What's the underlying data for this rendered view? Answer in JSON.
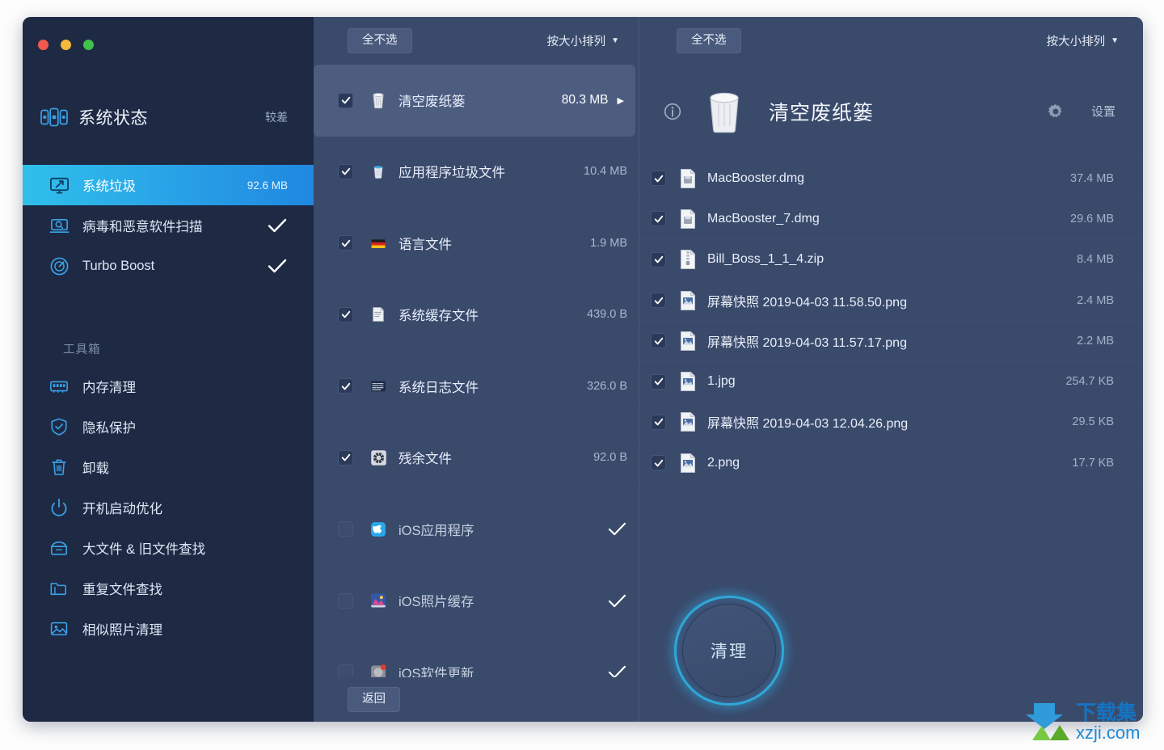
{
  "window": {
    "traffic_lights": [
      "close",
      "minimize",
      "zoom"
    ]
  },
  "sidebar": {
    "status": {
      "title": "系统状态",
      "value": "较差",
      "icon": "system-status-icon"
    },
    "nav_items": [
      {
        "label": "系统垃圾",
        "value": "92.6 MB",
        "icon": "monitor-clean-icon",
        "active": true
      },
      {
        "label": "病毒和恶意软件扫描",
        "value": "",
        "icon": "laptop-scan-icon",
        "active": false,
        "checked": true
      },
      {
        "label": "Turbo Boost",
        "value": "",
        "icon": "turbo-boost-icon",
        "active": false,
        "checked": true
      }
    ],
    "tools_label": "工具箱",
    "tools": [
      {
        "label": "内存清理",
        "icon": "memory-icon"
      },
      {
        "label": "隐私保护",
        "icon": "shield-check-icon"
      },
      {
        "label": "卸载",
        "icon": "trash-icon"
      },
      {
        "label": "开机启动优化",
        "icon": "power-icon"
      },
      {
        "label": "大文件 & 旧文件查找",
        "icon": "box-icon"
      },
      {
        "label": "重复文件查找",
        "icon": "folder-icon"
      },
      {
        "label": "相似照片清理",
        "icon": "photo-icon"
      }
    ]
  },
  "middle": {
    "deselect_label": "全不选",
    "sort_label": "按大小排列",
    "sort_caret": "▼",
    "back_label": "返回",
    "rows": [
      {
        "name": "清空废纸篓",
        "size": "80.3 MB",
        "icon": "trash-bin-icon",
        "checked": true,
        "selected": true,
        "arrow": "▶"
      },
      {
        "name": "应用程序垃圾文件",
        "size": "10.4 MB",
        "icon": "app-trash-icon",
        "checked": true,
        "selected": false
      },
      {
        "name": "语言文件",
        "size": "1.9 MB",
        "icon": "language-flag-icon",
        "checked": true,
        "selected": false
      },
      {
        "name": "系统缓存文件",
        "size": "439.0 B",
        "icon": "cache-doc-icon",
        "checked": true,
        "selected": false
      },
      {
        "name": "系统日志文件",
        "size": "326.0 B",
        "icon": "log-icon",
        "checked": true,
        "selected": false
      },
      {
        "name": "残余文件",
        "size": "92.0 B",
        "icon": "leftover-icon",
        "checked": true,
        "selected": false
      },
      {
        "name": "iOS应用程序",
        "size": "",
        "icon": "ios-app-icon",
        "checked": false,
        "selected": false,
        "done": true
      },
      {
        "name": "iOS照片缓存",
        "size": "",
        "icon": "ios-photo-icon",
        "checked": false,
        "selected": false,
        "done": true
      },
      {
        "name": "iOS软件更新",
        "size": "",
        "icon": "ios-update-icon",
        "checked": false,
        "selected": false,
        "done": true
      }
    ]
  },
  "right": {
    "deselect_label": "全不选",
    "sort_label": "按大小排列",
    "sort_caret": "▼",
    "title": "清空废纸篓",
    "settings_label": "设置",
    "clean_label": "清理",
    "files": [
      {
        "name": "MacBooster.dmg",
        "size": "37.4 MB",
        "icon": "dmg-file-icon",
        "checked": true
      },
      {
        "name": "MacBooster_7.dmg",
        "size": "29.6 MB",
        "icon": "dmg-file-icon",
        "checked": true
      },
      {
        "name": "Bill_Boss_1_1_4.zip",
        "size": "8.4 MB",
        "icon": "zip-file-icon",
        "checked": true
      },
      {
        "name": "屏幕快照 2019-04-03 11.58.50.png",
        "size": "2.4 MB",
        "icon": "image-file-icon",
        "checked": true
      },
      {
        "name": "屏幕快照 2019-04-03 11.57.17.png",
        "size": "2.2 MB",
        "icon": "image-file-icon",
        "checked": true
      },
      {
        "name": "1.jpg",
        "size": "254.7 KB",
        "icon": "image-file-icon",
        "checked": true
      },
      {
        "name": "屏幕快照 2019-04-03 12.04.26.png",
        "size": "29.5 KB",
        "icon": "image-file-icon",
        "checked": true
      },
      {
        "name": "2.png",
        "size": "17.7 KB",
        "icon": "image-file-icon",
        "checked": true
      }
    ]
  },
  "watermark": {
    "title": "下载集",
    "url": "xzji.com"
  },
  "colors": {
    "sidebar_bg": "#1e2a44",
    "panel_bg": "#3a4a6b",
    "accent": "#2aa6e8",
    "accent_ring": "#2fa7d8",
    "selected_row": "#4c5d80",
    "text_primary": "#e9effa",
    "text_muted": "#a3b1c8"
  }
}
